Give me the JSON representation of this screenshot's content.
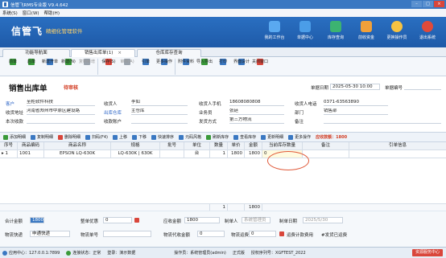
{
  "window": {
    "title": "信管飞RMS专业版 V9.4.642"
  },
  "menu": [
    "系统(S)",
    "窗口(W)",
    "帮助(H)"
  ],
  "banner": {
    "logo": "信管飞",
    "tagline": "精细化管理软件",
    "nav": [
      {
        "label": "我的工作台",
        "icon": "monitor-icon",
        "color": "#5aa9f0"
      },
      {
        "label": "单据中心",
        "icon": "document-grid-icon",
        "color": "#4b9de8"
      },
      {
        "label": "库存查询",
        "icon": "box-search-icon",
        "color": "#3cb371"
      },
      {
        "label": "前收资金",
        "icon": "money-icon",
        "color": "#f0a03a"
      },
      {
        "label": "更换操作员",
        "icon": "user-switch-icon",
        "color": "#f5c242"
      },
      {
        "label": "退出系统",
        "icon": "power-icon",
        "color": "#e04a3a"
      }
    ]
  },
  "tabs": [
    {
      "label": "功能导航面"
    },
    {
      "label": "销售出库单(1)",
      "close": "×"
    },
    {
      "label": "仓库库存查询"
    }
  ],
  "toolbar": [
    {
      "label": "前单",
      "icon": "arrow-left-icon",
      "color": "#3a9a3a",
      "disabled": false
    },
    {
      "label": "后单",
      "icon": "arrow-right-icon",
      "color": "#3a9a3a",
      "disabled": false
    },
    {
      "label": "新建开单",
      "icon": "new-doc-icon",
      "color": "#3a78c2",
      "disabled": false
    },
    {
      "label": "新建(N)",
      "icon": "add-icon",
      "color": "#3a9a3a",
      "disabled": false
    },
    {
      "label": "复制新增",
      "icon": "copy-icon",
      "color": "#9aa3ad",
      "disabled": true
    },
    {
      "label": "保存(S)",
      "icon": "save-icon",
      "color": "#d9463b",
      "disabled": false
    },
    {
      "label": "审核(A)",
      "icon": "audit-icon",
      "color": "#9aa3ad",
      "disabled": true
    },
    {
      "label": "引单",
      "icon": "import-order-icon",
      "color": "#3a78c2",
      "disabled": false
    },
    {
      "label": "更多操作",
      "icon": "more-icon",
      "color": "#3a78c2",
      "disabled": false
    },
    {
      "label": "附件资料",
      "icon": "attachment-icon",
      "color": "#3a78c2",
      "disabled": false
    },
    {
      "label": "导入导出",
      "icon": "import-export-icon",
      "color": "#3a9a3a",
      "disabled": false
    },
    {
      "label": "打印",
      "icon": "print-icon",
      "color": "#3a78c2",
      "disabled": false
    },
    {
      "label": "界面设计",
      "icon": "design-icon",
      "color": "#3a78c2",
      "disabled": false
    },
    {
      "label": "关闭窗口",
      "icon": "close-window-icon",
      "color": "#d9463b",
      "disabled": false
    }
  ],
  "form": {
    "title": "销售出库单",
    "status": "待审核",
    "date_label": "单据日期",
    "date_value": "2025-05-30 10:00",
    "docno_label": "单据编号",
    "docno_value": "",
    "customer_label": "客户",
    "customer_value": "至柜软件科技",
    "address_label": "收货地址",
    "address_value": "河南省郑州市中原区建设路",
    "received_label": "本次收款",
    "received_value": "",
    "consignee_label": "收货人",
    "consignee_value": "李如",
    "warehouse_label": "出库仓库",
    "warehouse_value": "主仓库",
    "account_label": "收款账户",
    "account_value": "",
    "mobile_label": "收货人手机",
    "mobile_value": "18608080808",
    "salesman_label": "业务员",
    "salesman_value": "张廷",
    "shipping_label": "发货方式",
    "shipping_value": "第三方物流",
    "phone_label": "收货人电话",
    "phone_value": "0371-63563890",
    "dept_label": "部门",
    "dept_value": "销售部",
    "remark_label": "备注",
    "remark_value": ""
  },
  "gridbar": [
    {
      "label": "添加明细",
      "icon": "add-row-icon",
      "color": "#3a9a3a"
    },
    {
      "label": "复制明细",
      "icon": "copy-row-icon",
      "color": "#3a78c2"
    },
    {
      "label": "删除明细",
      "icon": "delete-row-icon",
      "color": "#d9463b"
    },
    {
      "label": "扫码(F4)",
      "icon": "barcode-icon",
      "color": "#3a78c2"
    },
    {
      "label": "上移",
      "icon": "move-up-icon",
      "color": "#3a78c2"
    },
    {
      "label": "下移",
      "icon": "move-down-icon",
      "color": "#3a78c2"
    },
    {
      "label": "快速排序",
      "icon": "sort-icon",
      "color": "#3a78c2"
    },
    {
      "label": "元码风格",
      "icon": "style-icon",
      "color": "#3a78c2"
    },
    {
      "label": "刷新库存",
      "icon": "refresh-icon",
      "color": "#3a9a3a"
    },
    {
      "label": "查看库存",
      "icon": "view-stock-icon",
      "color": "#3a78c2"
    },
    {
      "label": "更新明细",
      "icon": "update-icon",
      "color": "#3a78c2"
    },
    {
      "label": "更多操作",
      "icon": "more-icon",
      "color": "#3a78c2"
    }
  ],
  "receivable_text": "应收款额：1800",
  "grid": {
    "columns": [
      "序号",
      "商品编码",
      "商品名称",
      "规格",
      "批号",
      "单位",
      "数量",
      "单价",
      "金额",
      "当前库存数量",
      "备注",
      "引单信息"
    ],
    "rows": [
      {
        "marker": "▸",
        "no": "1",
        "code": "1001",
        "name": "EPSON LQ-630K",
        "spec": "LQ-630K | 630K",
        "batch": "",
        "unit": "台",
        "qty": "1",
        "price": "1800",
        "amount": "1800",
        "stock": "0",
        "remark": "",
        "ref": ""
      }
    ],
    "totals": {
      "qty": "1",
      "amount": "1800"
    }
  },
  "footer": {
    "total_label": "合计金额",
    "total_value": "1800",
    "discount_label": "整单优惠",
    "discount_value": "0",
    "receivable_label": "应收金额",
    "receivable_value": "1800",
    "creator_label": "制单人",
    "creator_value": "系统管理员",
    "create_date_label": "制单日期",
    "create_date_value": "2025/5/30",
    "logistics_label": "物流快递",
    "logistics_value": "申通快递",
    "tracking_label": "物流单号",
    "tracking_value": "",
    "cod_label": "物流代收金额",
    "cod_value": "0",
    "freight_label": "物流运费",
    "freight_value": "0",
    "freight_check_label": "运费计款费用",
    "freight_hint": "#发货已运费"
  },
  "status": {
    "app_server": "应用中心：127.0.0.1:7899",
    "connection": "连接状态：正常",
    "login": "登录：演示数据",
    "operator": "操作员：系统管理员(admin)",
    "version": "正式版",
    "serial": "授权序列号：XGFTEST_2022",
    "button": "资源服务中心"
  }
}
